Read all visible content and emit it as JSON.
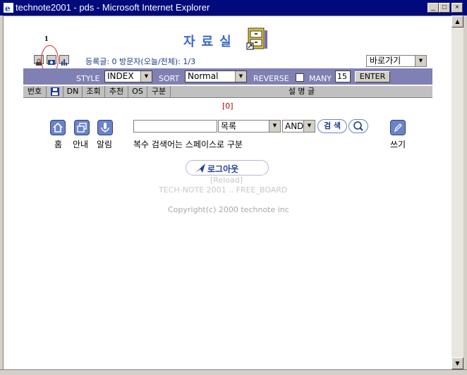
{
  "window": {
    "title": "technote2001 - pds - Microsoft Internet Explorer"
  },
  "board": {
    "logo_text": "자료실",
    "marker_number": "1",
    "stats": "등록글: 0   방문자(오늘/전체): 1/3",
    "goto_label": "바로가기"
  },
  "options": {
    "style_label": "STYLE",
    "style_value": "INDEX",
    "sort_label": "SORT",
    "sort_value": "Normal",
    "reverse_label": "REVERSE",
    "many_label": "MANY",
    "many_value": "15",
    "enter_label": "ENTER"
  },
  "columns": {
    "number": "번호",
    "dn": "DN",
    "views": "조회",
    "recommend": "추천",
    "os": "OS",
    "category": "구분",
    "description": "설 명 글"
  },
  "page_count": "[0]",
  "nav": {
    "home": "홈",
    "guide": "안내",
    "alert": "알림",
    "write": "쓰기"
  },
  "search": {
    "field_value": "목록",
    "logic_value": "AND",
    "button_label": "검 색",
    "hint": "복수 검색어는 스페이스로 구분"
  },
  "logout_label": "로그아웃",
  "footer": {
    "reload": "[Reload]",
    "board_name": "TECH-NOTE 2001 .. FREE_BOARD",
    "copyright": "Copyright(c) 2000 technote inc"
  }
}
